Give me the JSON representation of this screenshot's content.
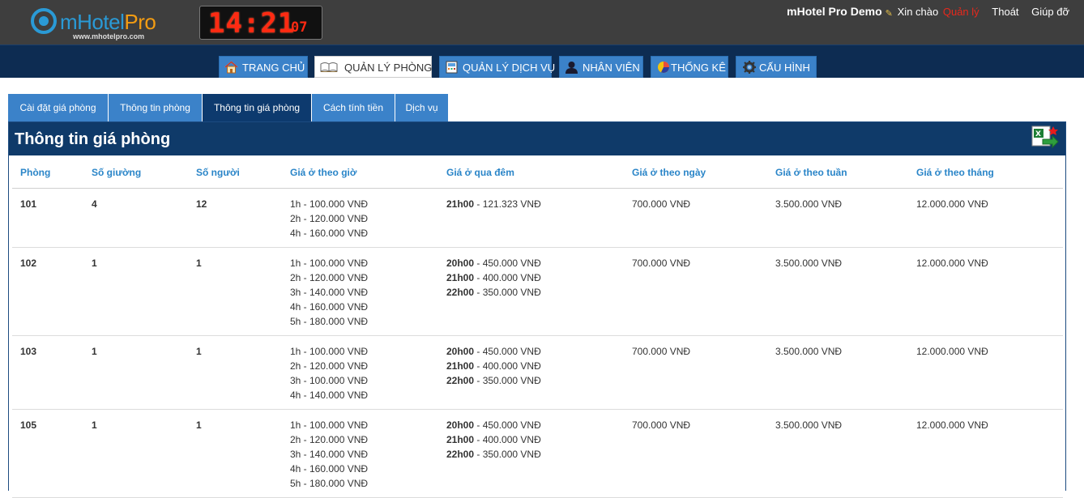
{
  "header": {
    "logo_text_m": "mHotel",
    "logo_text_pro": "Pro",
    "logo_url": "www.mhotelpro.com",
    "clock_main": "14:21",
    "clock_seconds": "07",
    "app_name": "mHotel Pro Demo",
    "greeting": "Xin chào",
    "user_name": "Quản lý",
    "logout": "Thoát",
    "help": "Giúp đỡ"
  },
  "nav": {
    "items": [
      {
        "label": "TRANG CHỦ",
        "icon": "home-icon"
      },
      {
        "label": "QUẢN LÝ PHÒNG",
        "icon": "book-icon"
      },
      {
        "label": "QUẢN LÝ DỊCH VỤ",
        "icon": "service-icon"
      },
      {
        "label": "NHÂN VIÊN",
        "icon": "staff-icon"
      },
      {
        "label": "THỐNG KÊ",
        "icon": "pie-chart-icon"
      },
      {
        "label": "CẤU HÌNH",
        "icon": "gear-icon"
      }
    ],
    "active_index": 1
  },
  "subtabs": {
    "items": [
      "Cài đặt giá phòng",
      "Thông tin phòng",
      "Thông tin giá phòng",
      "Cách tính tiền",
      "Dịch vụ"
    ],
    "active_index": 2
  },
  "panel": {
    "title": "Thông tin giá phòng",
    "export_icon": "excel-export-icon"
  },
  "table": {
    "headers": [
      "Phòng",
      "Số giường",
      "Số người",
      "Giá ở theo giờ",
      "Giá ở qua đêm",
      "Giá ở theo ngày",
      "Giá ở theo tuần",
      "Giá ở theo tháng"
    ],
    "rows": [
      {
        "room": "101",
        "beds": "4",
        "people": "12",
        "hourly": [
          "1h - 100.000 VNĐ",
          "2h - 120.000 VNĐ",
          "4h - 160.000 VNĐ"
        ],
        "overnight": [
          {
            "time": "21h00",
            "price": " - 121.323 VNĐ"
          }
        ],
        "daily": "700.000 VNĐ",
        "weekly": "3.500.000 VNĐ",
        "monthly": "12.000.000 VNĐ"
      },
      {
        "room": "102",
        "beds": "1",
        "people": "1",
        "hourly": [
          "1h - 100.000 VNĐ",
          "2h - 120.000 VNĐ",
          "3h - 140.000 VNĐ",
          "4h - 160.000 VNĐ",
          "5h - 180.000 VNĐ"
        ],
        "overnight": [
          {
            "time": "20h00",
            "price": " - 450.000 VNĐ"
          },
          {
            "time": "21h00",
            "price": " - 400.000 VNĐ"
          },
          {
            "time": "22h00",
            "price": " - 350.000 VNĐ"
          }
        ],
        "daily": "700.000 VNĐ",
        "weekly": "3.500.000 VNĐ",
        "monthly": "12.000.000 VNĐ"
      },
      {
        "room": "103",
        "beds": "1",
        "people": "1",
        "hourly": [
          "1h - 100.000 VNĐ",
          "2h - 120.000 VNĐ",
          "3h - 100.000 VNĐ",
          "4h - 140.000 VNĐ"
        ],
        "overnight": [
          {
            "time": "20h00",
            "price": " - 450.000 VNĐ"
          },
          {
            "time": "21h00",
            "price": " - 400.000 VNĐ"
          },
          {
            "time": "22h00",
            "price": " - 350.000 VNĐ"
          }
        ],
        "daily": "700.000 VNĐ",
        "weekly": "3.500.000 VNĐ",
        "monthly": "12.000.000 VNĐ"
      },
      {
        "room": "105",
        "beds": "1",
        "people": "1",
        "hourly": [
          "1h - 100.000 VNĐ",
          "2h - 120.000 VNĐ",
          "3h - 140.000 VNĐ",
          "4h - 160.000 VNĐ",
          "5h - 180.000 VNĐ"
        ],
        "overnight": [
          {
            "time": "20h00",
            "price": " - 450.000 VNĐ"
          },
          {
            "time": "21h00",
            "price": " - 400.000 VNĐ"
          },
          {
            "time": "22h00",
            "price": " - 350.000 VNĐ"
          }
        ],
        "daily": "700.000 VNĐ",
        "weekly": "3.500.000 VNĐ",
        "monthly": "12.000.000 VNĐ"
      }
    ]
  }
}
